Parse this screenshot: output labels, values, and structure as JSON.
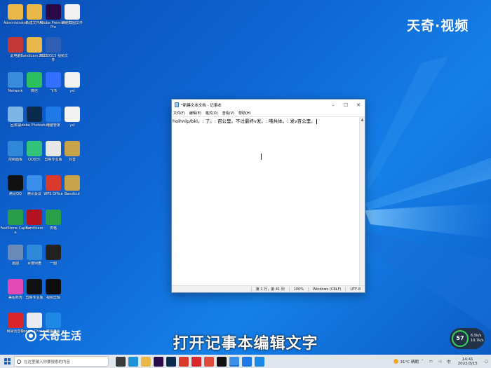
{
  "brand": {
    "top_right": "天奇·视频",
    "bottom_left": "天奇生活"
  },
  "caption": "打开记事本编辑文字",
  "desktop_icons": [
    {
      "label": "Administrator",
      "icon": "user-folder-icon",
      "color": "#e8b84a"
    },
    {
      "label": "新建文件夹",
      "icon": "folder-icon",
      "color": "#e8b84a"
    },
    {
      "label": "Adobe Premiere Pro",
      "icon": "premiere-icon",
      "color": "#2b0a49"
    },
    {
      "label": "微信截图文件",
      "icon": "document-icon",
      "color": "#f2f2f2"
    },
    {
      "label": "此电脑",
      "icon": "computer-icon",
      "color": "#c43838"
    },
    {
      "label": "Bandicam 2021",
      "icon": "bandicam-icon",
      "color": "#e8b84a"
    },
    {
      "label": "20220315 视频文件",
      "icon": "word-doc-icon",
      "color": "#2f5fb3"
    },
    {
      "label": "Network",
      "icon": "network-icon",
      "color": "#3a8bdc"
    },
    {
      "label": "微信",
      "icon": "wechat-icon",
      "color": "#2dbe60"
    },
    {
      "label": "飞书",
      "icon": "feishu-icon",
      "color": "#3370ff"
    },
    {
      "label": "yxl",
      "icon": "document-icon",
      "color": "#f2f2f2"
    },
    {
      "label": "回收站",
      "icon": "recycle-bin-icon",
      "color": "#7fb4e6"
    },
    {
      "label": "Adobe Photoshop",
      "icon": "photoshop-icon",
      "color": "#0a2b4d"
    },
    {
      "label": "电脑管家",
      "icon": "pc-manager-icon",
      "color": "#1f7ae8"
    },
    {
      "label": "yxl",
      "icon": "document-icon",
      "color": "#f2f2f2"
    },
    {
      "label": "控制面板",
      "icon": "control-panel-icon",
      "color": "#2f88d8"
    },
    {
      "label": "QQ音乐",
      "icon": "qq-music-icon",
      "color": "#31c27c"
    },
    {
      "label": "剪映专业版",
      "icon": "pdf-icon",
      "color": "#e8e8e8"
    },
    {
      "label": "抖音",
      "icon": "archive-icon",
      "color": "#c9a34b"
    },
    {
      "label": "腾讯QQ",
      "icon": "qq-icon",
      "color": "#111111"
    },
    {
      "label": "腾讯会议",
      "icon": "meeting-icon",
      "color": "#3a8fe8"
    },
    {
      "label": "WPS Office",
      "icon": "wps-icon",
      "color": "#d93a2b"
    },
    {
      "label": "Bandicut",
      "icon": "archive-icon",
      "color": "#c9a34b"
    },
    {
      "label": "FastStone Capture",
      "icon": "faststone-icon",
      "color": "#2a9d4a"
    },
    {
      "label": "Bandicam",
      "icon": "bandicam-red-icon",
      "color": "#b3121f"
    },
    {
      "label": "表格",
      "icon": "spreadsheet-icon",
      "color": "#2aa04a"
    },
    {
      "label": "画图",
      "icon": "paint-icon",
      "color": "#6a8bb8"
    },
    {
      "label": "百度网盘",
      "icon": "baidu-icon",
      "color": "#2f88d8"
    },
    {
      "label": "一图",
      "icon": "photo-icon",
      "color": "#222222"
    },
    {
      "label": "美图秀秀",
      "icon": "meitu-icon",
      "color": "#e04ab2"
    },
    {
      "label": "剪映专业版",
      "icon": "capcut-icon",
      "color": "#111111"
    },
    {
      "label": "视频剪辑",
      "icon": "black-square-icon",
      "color": "#0d0d0d"
    },
    {
      "label": "网易云音乐",
      "icon": "netease-icon",
      "color": "#d8262c"
    },
    {
      "label": "Google Chrome",
      "icon": "chrome-icon",
      "color": "#e8eaed"
    },
    {
      "label": "酷狗音乐",
      "icon": "kugou-icon",
      "color": "#1e88e5"
    }
  ],
  "notepad": {
    "title": "*新建文本文档 - 记事本",
    "menu": [
      "文件(F)",
      "编辑(E)",
      "格式(O)",
      "查看(V)",
      "帮助(H)"
    ],
    "content": "hoihnlp/bkl。: 了。: 百公里。不过最终v发。: 哦共体。: 发v百公里。",
    "status": {
      "position": "第 1 行，第 41 列",
      "zoom": "100%",
      "line_ending": "Windows (CRLF)",
      "encoding": "UTF-8"
    }
  },
  "taskbar": {
    "search_placeholder": "在这里输入你要搜索的内容",
    "apps": [
      {
        "icon": "task-view-icon",
        "color": "#3a3a3a"
      },
      {
        "icon": "edge-icon",
        "color": "#1f8fd8"
      },
      {
        "icon": "file-explorer-icon",
        "color": "#e8b84a"
      },
      {
        "icon": "premiere-icon",
        "color": "#2b0a49"
      },
      {
        "icon": "photoshop-icon",
        "color": "#0a2b4d"
      },
      {
        "icon": "wps-icon",
        "color": "#d93a2b"
      },
      {
        "icon": "netease-icon",
        "color": "#d8262c"
      },
      {
        "icon": "chrome-icon",
        "color": "#e04a3a"
      },
      {
        "icon": "capcut-icon",
        "color": "#111111"
      },
      {
        "icon": "notepad-icon",
        "color": "#3a8fe8"
      },
      {
        "icon": "pc-manager-icon",
        "color": "#1f7ae8"
      },
      {
        "icon": "kugou-icon",
        "color": "#1e88e5"
      }
    ],
    "weather": "31°C 晴朗",
    "time": "14:41",
    "date": "2022/3/15"
  },
  "speed_widget": {
    "percent": "57",
    "up": "6.5k/s",
    "down": "10.7k/s"
  }
}
